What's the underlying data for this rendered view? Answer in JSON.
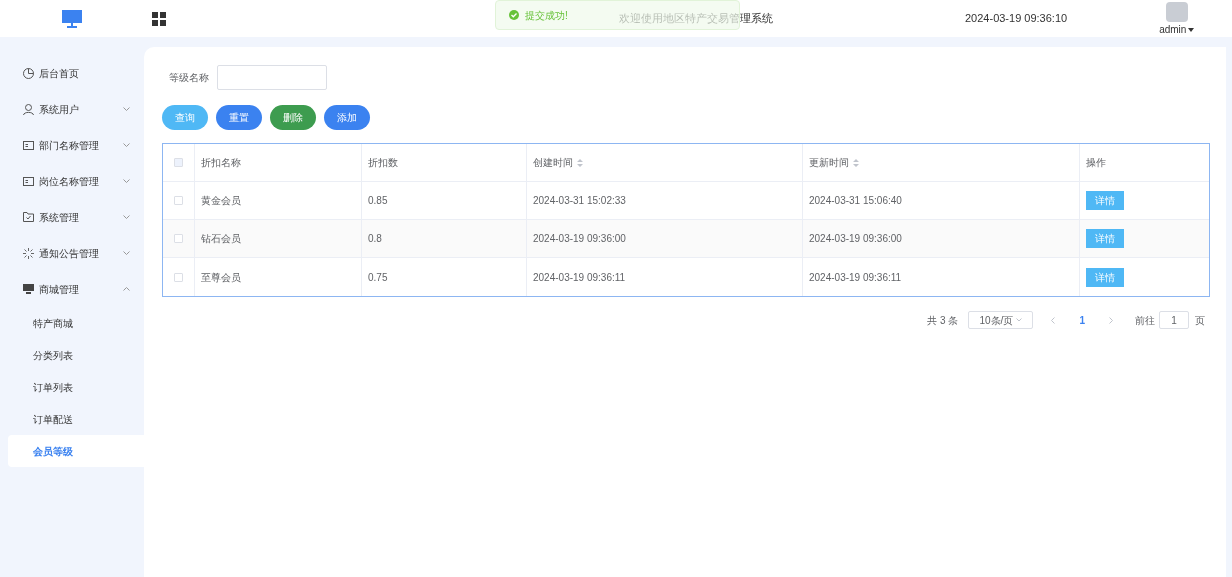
{
  "header": {
    "title": "欢迎使用地区特产交易管理系统",
    "datetime": "2024-03-19 09:36:10",
    "user": "admin"
  },
  "toast": {
    "message": "提交成功!"
  },
  "sidebar": {
    "items": [
      {
        "label": "后台首页"
      },
      {
        "label": "系统用户",
        "expanded": false
      },
      {
        "label": "部门名称管理",
        "expanded": false
      },
      {
        "label": "岗位名称管理",
        "expanded": false
      },
      {
        "label": "系统管理",
        "expanded": false
      },
      {
        "label": "通知公告管理",
        "expanded": false
      },
      {
        "label": "商城管理",
        "expanded": true,
        "children": [
          {
            "label": "特产商城",
            "selected": false
          },
          {
            "label": "分类列表",
            "selected": false
          },
          {
            "label": "订单列表",
            "selected": false
          },
          {
            "label": "订单配送",
            "selected": false
          },
          {
            "label": "会员等级",
            "selected": true
          }
        ]
      }
    ]
  },
  "search": {
    "label": "等级名称"
  },
  "buttons": [
    {
      "label": "查询",
      "color": "#4fb8f5"
    },
    {
      "label": "重置",
      "color": "#3b82f0"
    },
    {
      "label": "删除",
      "color": "#3d9c4f"
    },
    {
      "label": "添加",
      "color": "#3b82f0"
    }
  ],
  "table": {
    "select_all_checked": false,
    "columns": [
      {
        "label": "折扣名称",
        "sortable": false
      },
      {
        "label": "折扣数",
        "sortable": false
      },
      {
        "label": "创建时间",
        "sortable": true
      },
      {
        "label": "更新时间",
        "sortable": true
      },
      {
        "label": "操作",
        "sortable": false
      }
    ],
    "rows": [
      {
        "checked": false,
        "cells": [
          "黄金会员",
          "0.85",
          "2024-03-31 15:02:33",
          "2024-03-31 15:06:40"
        ],
        "action": "详情"
      },
      {
        "checked": false,
        "cells": [
          "钻石会员",
          "0.8",
          "2024-03-19 09:36:00",
          "2024-03-19 09:36:00"
        ],
        "action": "详情"
      },
      {
        "checked": false,
        "cells": [
          "至尊会员",
          "0.75",
          "2024-03-19 09:36:11",
          "2024-03-19 09:36:11"
        ],
        "action": "详情"
      }
    ]
  },
  "pagination": {
    "total": "共 3 条",
    "page_size": "10条/页",
    "current_page": "1",
    "goto_label": "前往",
    "goto_value": "1",
    "page_suffix": "页"
  }
}
